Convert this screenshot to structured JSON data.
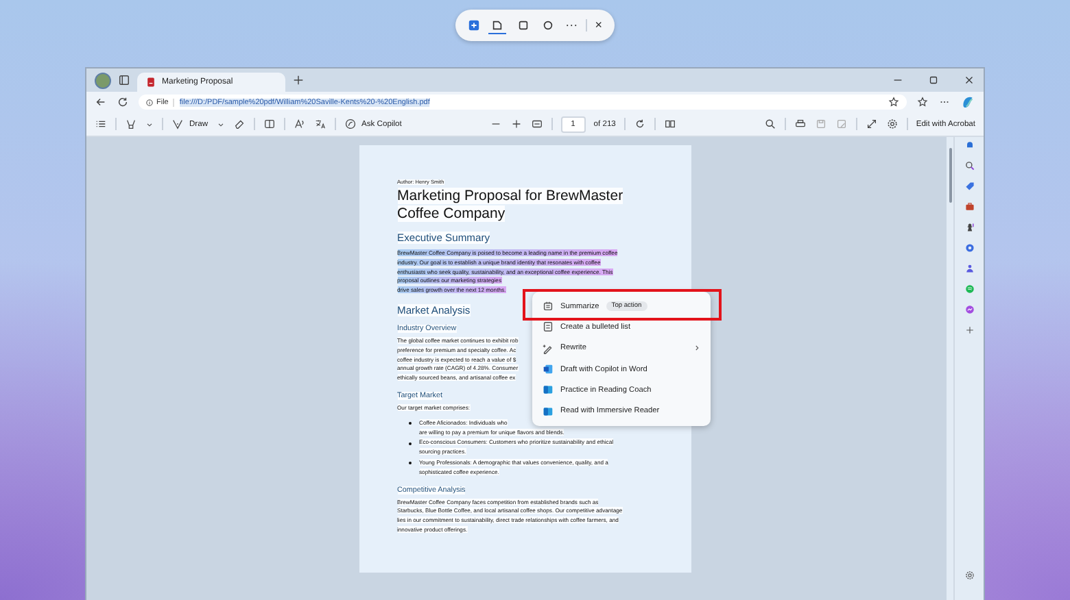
{
  "snip_toolbar": {
    "modes": [
      {
        "selected": true
      },
      {
        "selected": false
      },
      {
        "selected": false
      }
    ],
    "more": "···",
    "close": "×"
  },
  "browser": {
    "tab": {
      "title": "Marketing Proposal",
      "selected": true
    },
    "address": {
      "scheme_label": "File",
      "url": "file:///D:/PDF/sample%20pdf/William%20Saville-Kents%20-%20English.pdf"
    },
    "pdf_toolbar": {
      "draw_label": "Draw",
      "copilot_label": "Ask Copilot",
      "page": "1",
      "page_total": "of 213",
      "edit_label": "Edit with Acrobat"
    },
    "document": {
      "author": "Author: Henry Smith",
      "title": "Marketing Proposal for BrewMaster Coffee Company",
      "blocks": [
        {
          "kind": "heading",
          "text": "Executive Summary"
        },
        {
          "kind": "paragraph",
          "highlighted": true,
          "lines": [
            "BrewMaster Coffee Company is poised to become a leading name in the premium coffee",
            "industry. Our goal is to establish a unique brand identity that resonates with coffee",
            "enthusiasts who seek quality, sustainability, and an exceptional coffee experience. This",
            "proposal outlines our marketing strategies",
            "drive sales growth over the next 12 months."
          ]
        },
        {
          "kind": "heading",
          "text": "Market Analysis"
        },
        {
          "kind": "subheading",
          "text": "Industry Overview"
        },
        {
          "kind": "paragraph",
          "highlighted": false,
          "lines": [
            "The global coffee market continues to exhibit rob",
            "preference for premium and specialty coffee. Ac",
            "coffee industry is expected to reach a value of $",
            "annual growth rate (CAGR) of 4.28%. Consumer",
            "ethically sourced beans, and artisanal coffee ex"
          ]
        },
        {
          "kind": "subheading",
          "text": "Target Market"
        },
        {
          "kind": "paragraph",
          "highlighted": false,
          "lines": [
            "Our target market comprises:"
          ]
        },
        {
          "kind": "bullets",
          "items": [
            {
              "lines": [
                "Coffee Aficionados: Individuals who",
                "are willing to pay a premium for unique flavors and blends."
              ]
            },
            {
              "lines": [
                "Eco-conscious Consumers: Customers who prioritize sustainability and ethical",
                "sourcing practices."
              ]
            },
            {
              "lines": [
                "Young Professionals: A demographic that values convenience, quality, and a",
                "sophisticated coffee experience."
              ]
            }
          ]
        },
        {
          "kind": "subheading",
          "text": "Competitive Analysis"
        },
        {
          "kind": "paragraph",
          "highlighted": false,
          "lines": [
            "BrewMaster Coffee Company faces competition from established brands such as",
            "Starbucks, Blue Bottle Coffee, and local artisanal coffee shops. Our competitive advantage",
            "lies in our commitment to sustainability, direct trade relationships with coffee farmers, and",
            "innovative product offerings."
          ]
        }
      ]
    },
    "context_menu": {
      "items": [
        {
          "kind": "summarize",
          "label": "Summarize",
          "badge": "Top action",
          "has_submenu": false,
          "highlighted": true
        },
        {
          "kind": "list",
          "label": "Create a bulleted list",
          "has_submenu": false,
          "highlighted": false
        },
        {
          "kind": "rewrite",
          "label": "Rewrite",
          "has_submenu": true,
          "highlighted": false
        },
        {
          "kind": "word",
          "label": "Draft with Copilot in Word",
          "has_submenu": false,
          "highlighted": false
        },
        {
          "kind": "coach",
          "label": "Practice in Reading Coach",
          "has_submenu": false,
          "highlighted": false
        },
        {
          "kind": "reader",
          "label": "Read with Immersive Reader",
          "has_submenu": false,
          "highlighted": false
        }
      ]
    }
  }
}
